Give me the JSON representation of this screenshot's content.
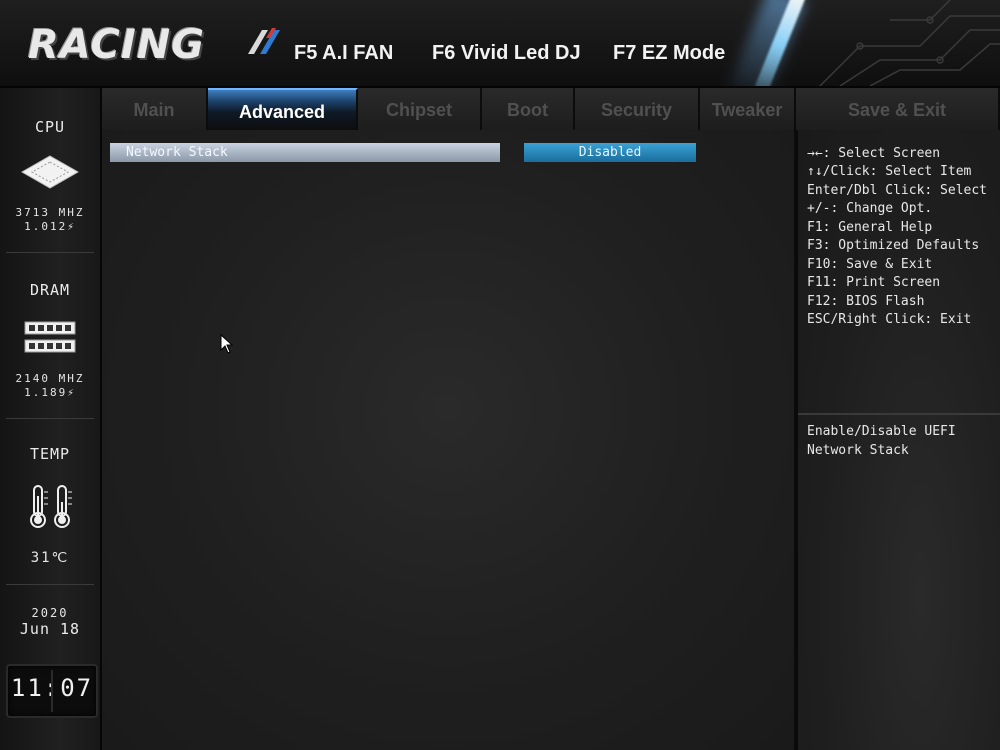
{
  "header": {
    "logo_text": "RACING",
    "hotkeys": [
      "F5 A.I FAN",
      "F6 Vivid Led DJ",
      "F7 EZ Mode"
    ]
  },
  "sidebar": {
    "cpu": {
      "title": "CPU",
      "freq": "3713 MHZ",
      "volt": "1.012⚡"
    },
    "dram": {
      "title": "DRAM",
      "freq": "2140 MHZ",
      "volt": "1.189⚡"
    },
    "temp": {
      "title": "TEMP",
      "value": "31℃"
    },
    "date": {
      "year": "2020",
      "day": "Jun 18"
    },
    "clock": "11:07"
  },
  "tabs": [
    {
      "label": "Main"
    },
    {
      "label": "Advanced"
    },
    {
      "label": "Chipset"
    },
    {
      "label": "Boot"
    },
    {
      "label": "Security"
    },
    {
      "label": "Tweaker"
    },
    {
      "label": "Save & Exit"
    }
  ],
  "active_tab": "Advanced",
  "main": {
    "option_label": "Network Stack",
    "option_value": "Disabled"
  },
  "help": {
    "lines": [
      "→←: Select Screen",
      "↑↓/Click: Select Item",
      "Enter/Dbl Click: Select",
      "+/-: Change Opt.",
      "F1: General Help",
      "F3: Optimized Defaults",
      "F10: Save & Exit",
      "F11: Print Screen",
      "F12: BIOS Flash",
      "ESC/Right Click: Exit"
    ],
    "description": [
      "Enable/Disable UEFI",
      "Network Stack"
    ]
  },
  "colors": {
    "accent": "#2a8fc4",
    "active_tab_top": "#6fb6ff",
    "option_highlight": "#aab6c4"
  }
}
